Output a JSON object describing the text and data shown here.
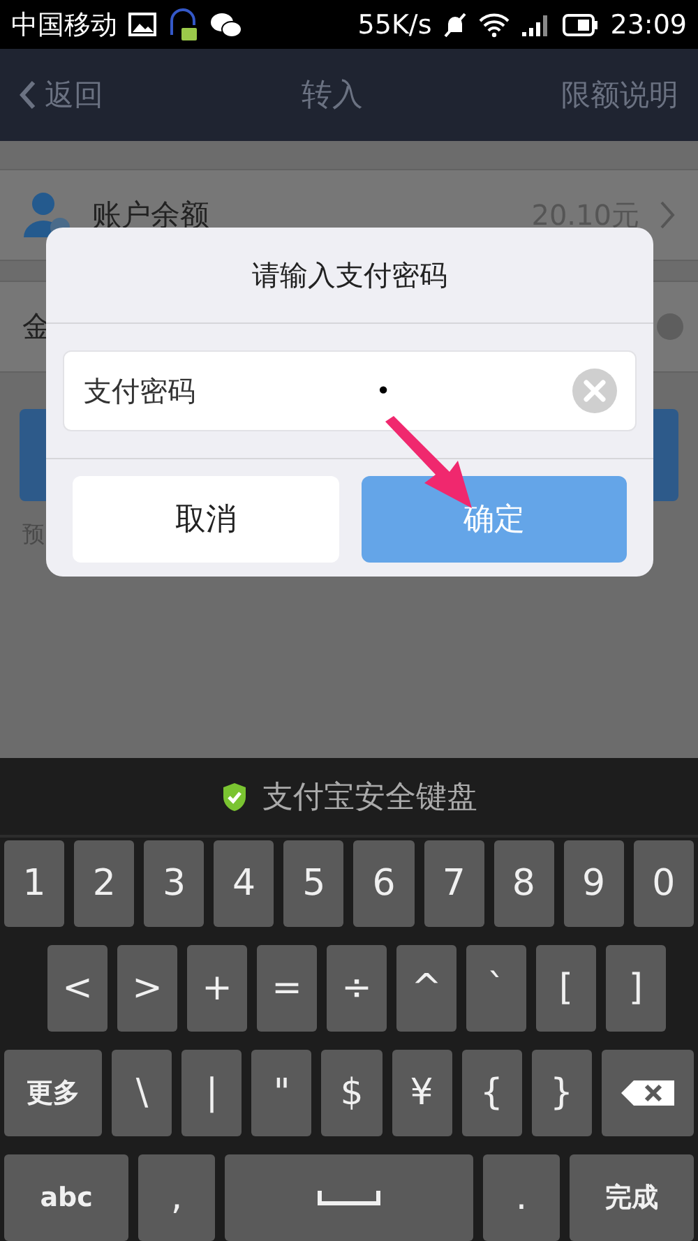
{
  "status_bar": {
    "carrier": "中国移动",
    "speed": "55K/s",
    "time": "23:09"
  },
  "nav": {
    "back": "返回",
    "title": "转入",
    "action": "限额说明"
  },
  "background": {
    "balance_row": {
      "label": "账户余额",
      "value": "20.10元"
    },
    "amount_row": {
      "label": "金"
    },
    "note": "预"
  },
  "dialog": {
    "title": "请输入支付密码",
    "field": {
      "label": "支付密码",
      "value": "•"
    },
    "buttons": [
      {
        "label": "取消",
        "kind": "cancel"
      },
      {
        "label": "确定",
        "kind": "confirm"
      }
    ]
  },
  "keyboard": {
    "title": "支付宝安全键盘",
    "rows": [
      {
        "kind": "full",
        "keys": [
          {
            "kind": "char",
            "label": "1"
          },
          {
            "kind": "char",
            "label": "2"
          },
          {
            "kind": "char",
            "label": "3"
          },
          {
            "kind": "char",
            "label": "4"
          },
          {
            "kind": "char",
            "label": "5"
          },
          {
            "kind": "char",
            "label": "6"
          },
          {
            "kind": "char",
            "label": "7"
          },
          {
            "kind": "char",
            "label": "8"
          },
          {
            "kind": "char",
            "label": "9"
          },
          {
            "kind": "char",
            "label": "0"
          }
        ]
      },
      {
        "kind": "indented",
        "keys": [
          {
            "kind": "char",
            "label": "<"
          },
          {
            "kind": "char",
            "label": ">"
          },
          {
            "kind": "char",
            "label": "+"
          },
          {
            "kind": "char",
            "label": "="
          },
          {
            "kind": "char",
            "label": "÷"
          },
          {
            "kind": "char",
            "label": "^"
          },
          {
            "kind": "char",
            "label": "`"
          },
          {
            "kind": "char",
            "label": "["
          },
          {
            "kind": "char",
            "label": "]"
          }
        ]
      },
      {
        "kind": "full",
        "keys": [
          {
            "kind": "wide",
            "label": "更多"
          },
          {
            "kind": "char",
            "label": "\\"
          },
          {
            "kind": "char",
            "label": "|"
          },
          {
            "kind": "char",
            "label": "\""
          },
          {
            "kind": "char",
            "label": "$"
          },
          {
            "kind": "char",
            "label": "¥"
          },
          {
            "kind": "char",
            "label": "{"
          },
          {
            "kind": "char",
            "label": "}"
          },
          {
            "kind": "backspace"
          }
        ]
      },
      {
        "kind": "full",
        "keys": [
          {
            "kind": "wide",
            "label": "abc"
          },
          {
            "kind": "char",
            "label": ","
          },
          {
            "kind": "space"
          },
          {
            "kind": "char",
            "label": "."
          },
          {
            "kind": "wide",
            "label": "完成"
          }
        ]
      }
    ]
  }
}
